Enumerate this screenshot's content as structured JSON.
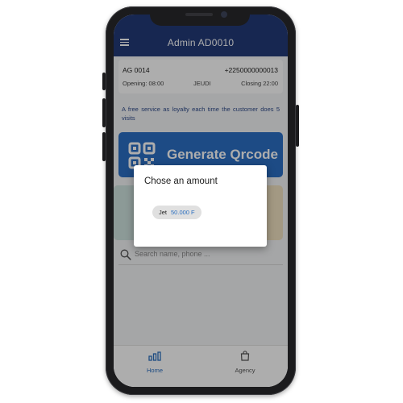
{
  "header": {
    "title": "Admin AD0010"
  },
  "agency": {
    "code": "AG 0014",
    "phone": "+2250000000013",
    "opening": "Opening: 08:00",
    "day": "JEUDI",
    "closing": "Closing 22:00"
  },
  "promo": {
    "text": "A free service as loyalty each time the customer does 5 visits"
  },
  "qr_button": {
    "label": "Generate Qrcode"
  },
  "search": {
    "placeholder": "Search name, phone ..."
  },
  "bottom_nav": {
    "items": [
      {
        "label": "Home",
        "icon": "bar-chart-icon",
        "active": true
      },
      {
        "label": "Agency",
        "icon": "shopping-bag-icon",
        "active": false
      }
    ]
  },
  "dialog": {
    "title": "Chose an amount",
    "options": [
      {
        "name": "Jet",
        "amount": "50.000 F"
      }
    ]
  },
  "colors": {
    "appbar": "#223a78",
    "qr_button": "#2c6fc5",
    "accent": "#2b6fc0",
    "overlay": "rgba(0,0,0,0.32)"
  }
}
